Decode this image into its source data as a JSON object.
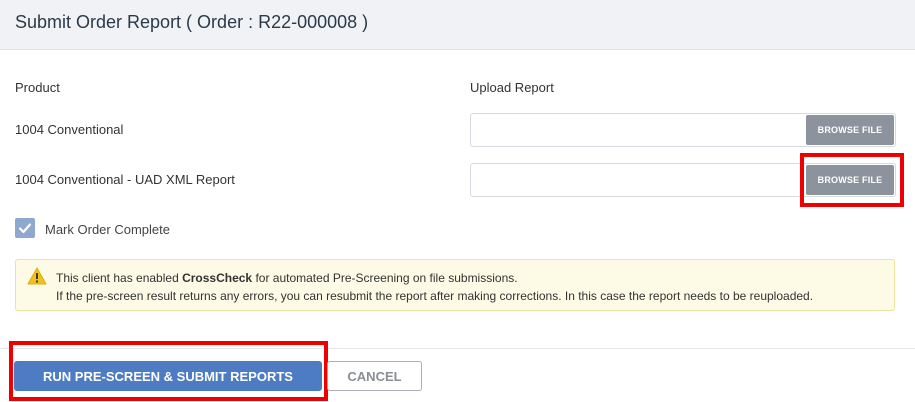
{
  "header": {
    "title": "Submit Order Report ( Order : R22-000008 )"
  },
  "columns": {
    "product": "Product",
    "upload": "Upload Report"
  },
  "products": [
    {
      "name": "1004 Conventional",
      "file_value": "",
      "browse_label": "BROWSE FILE"
    },
    {
      "name": "1004 Conventional - UAD XML Report",
      "file_value": "",
      "browse_label": "BROWSE FILE"
    }
  ],
  "mark_complete": {
    "label": "Mark Order Complete",
    "checked": true
  },
  "alert": {
    "line1_before": "This client has enabled ",
    "line1_bold": "CrossCheck",
    "line1_after": " for automated Pre-Screening on file submissions.",
    "line2": "If the pre-screen result returns any errors, you can resubmit the report after making corrections. In this case the report needs to be reuploaded.",
    "icon": "warning-icon"
  },
  "actions": {
    "submit_label": "RUN PRE-SCREEN & SUBMIT REPORTS",
    "cancel_label": "CANCEL"
  },
  "colors": {
    "primary": "#4d7cc2",
    "browse": "#8d939c",
    "highlight": "#ee0000",
    "alert_bg": "#fdfae6",
    "warning": "#f2c21c"
  }
}
